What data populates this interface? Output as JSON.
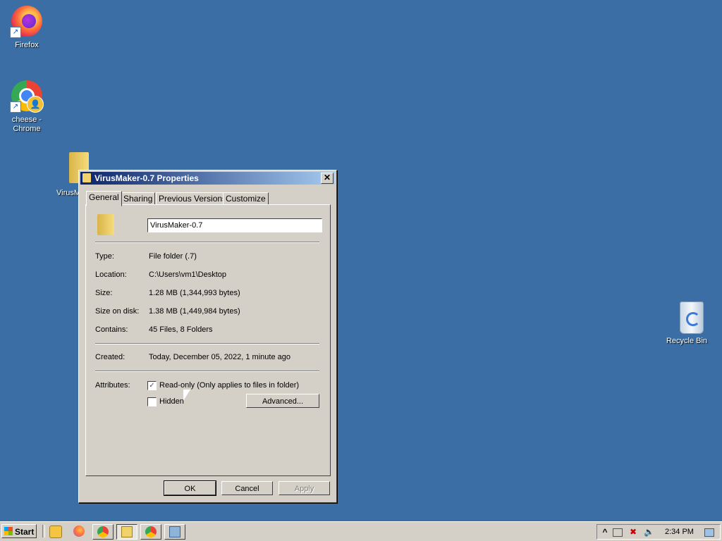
{
  "desktop": {
    "icons": [
      {
        "label": "Firefox"
      },
      {
        "label": "cheese -\nChrome"
      },
      {
        "label": "VirusMa"
      },
      {
        "label": "Recycle Bin"
      }
    ]
  },
  "dialog": {
    "title": "VirusMaker-0.7 Properties",
    "close_label": "✕",
    "tabs": [
      "General",
      "Sharing",
      "Previous Versions",
      "Customize"
    ],
    "active_tab": "General",
    "name_value": "VirusMaker-0.7",
    "fields": [
      {
        "label": "Type:",
        "value": "File folder (.7)"
      },
      {
        "label": "Location:",
        "value": "C:\\Users\\vm1\\Desktop"
      },
      {
        "label": "Size:",
        "value": "1.28 MB (1,344,993 bytes)"
      },
      {
        "label": "Size on disk:",
        "value": "1.38 MB (1,449,984 bytes)"
      },
      {
        "label": "Contains:",
        "value": "45 Files, 8 Folders"
      }
    ],
    "created": {
      "label": "Created:",
      "value": "Today, December 05, 2022, 1 minute ago"
    },
    "attributes": {
      "label": "Attributes:",
      "readonly_label": "Read-only (Only applies to files in folder)",
      "readonly_checked": true,
      "hidden_label": "Hidden",
      "hidden_checked": false,
      "advanced_label": "Advanced..."
    },
    "buttons": {
      "ok": "OK",
      "cancel": "Cancel",
      "apply": "Apply"
    }
  },
  "taskbar": {
    "start_label": "Start",
    "clock": "2:34 PM",
    "tray_expand": "^"
  }
}
